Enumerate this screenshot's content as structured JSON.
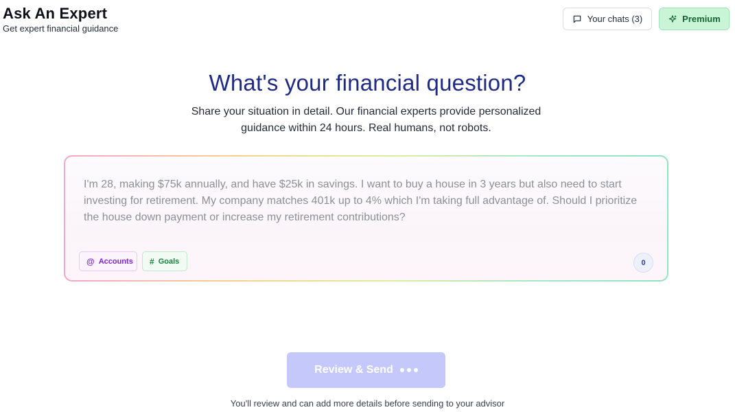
{
  "header": {
    "title": "Ask An Expert",
    "subtitle": "Get expert financial guidance"
  },
  "top_actions": {
    "chats_label": "Your chats (3)",
    "chats_icon": "message-square-icon",
    "premium_label": "Premium",
    "premium_icon": "sparkles-icon"
  },
  "hero": {
    "title": "What's your financial question?",
    "subtitle": "Share your situation in detail. Our financial experts provide personalized guidance within 24 hours. Real humans, not robots."
  },
  "composer": {
    "placeholder": "I'm 28, making $75k annually, and have $25k in savings. I want to buy a house in 3 years but also need to start investing for retirement. My company matches 401k up to 4% which I'm taking full advantage of. Should I prioritize the house down payment or increase my retirement contributions?",
    "chips": [
      {
        "symbol": "@",
        "label": "Accounts"
      },
      {
        "symbol": "#",
        "label": "Goals"
      }
    ],
    "char_count": "0"
  },
  "submit": {
    "label": "Review & Send",
    "state": "disabled"
  },
  "footnote": "You'll review and can add more details before sending to your advisor",
  "colors": {
    "title_navy": "#1e2a86",
    "premium_bg": "#c9f5d6",
    "send_disabled_bg": "#c5c8fb",
    "accounts_purple": "#7e22ce",
    "goals_green": "#15803d"
  }
}
